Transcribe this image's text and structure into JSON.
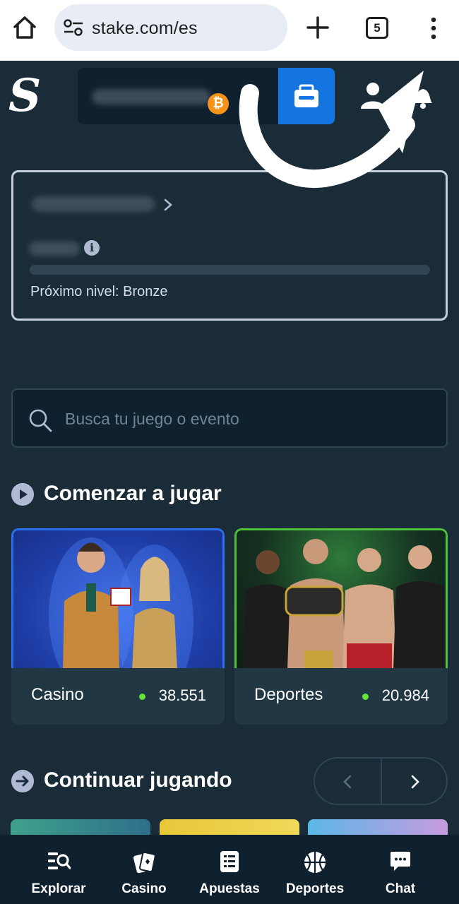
{
  "browser": {
    "url": "stake.com/es",
    "tab_count": "5",
    "icons": [
      "home-icon",
      "site-settings-icon",
      "new-tab-icon",
      "tab-switcher-icon",
      "more-options-icon"
    ]
  },
  "header": {
    "logo": "S",
    "currency_icon": "bitcoin-icon",
    "currency_symbol": "₿",
    "wallet_icon": "wallet-icon"
  },
  "vip": {
    "next_level": "Próximo nivel: Bronze",
    "progress": 0,
    "info_glyph": "i"
  },
  "search": {
    "placeholder": "Busca tu juego o evento"
  },
  "sections": {
    "start": "Comenzar a jugar",
    "continue": "Continuar jugando"
  },
  "categories": [
    {
      "label": "Casino",
      "count": "38.551",
      "border": "#2e6ef0"
    },
    {
      "label": "Deportes",
      "count": "20.984",
      "border": "#4fc23c"
    }
  ],
  "bottom_nav": [
    {
      "label": "Explorar",
      "icon": "browse-icon"
    },
    {
      "label": "Casino",
      "icon": "cards-icon"
    },
    {
      "label": "Apuestas",
      "icon": "betslip-icon"
    },
    {
      "label": "Deportes",
      "icon": "basketball-icon"
    },
    {
      "label": "Chat",
      "icon": "chat-icon"
    }
  ],
  "colors": {
    "background": "#1a2c38",
    "panel": "#0f212e",
    "accent": "#1475e1",
    "online": "#62e33a"
  }
}
